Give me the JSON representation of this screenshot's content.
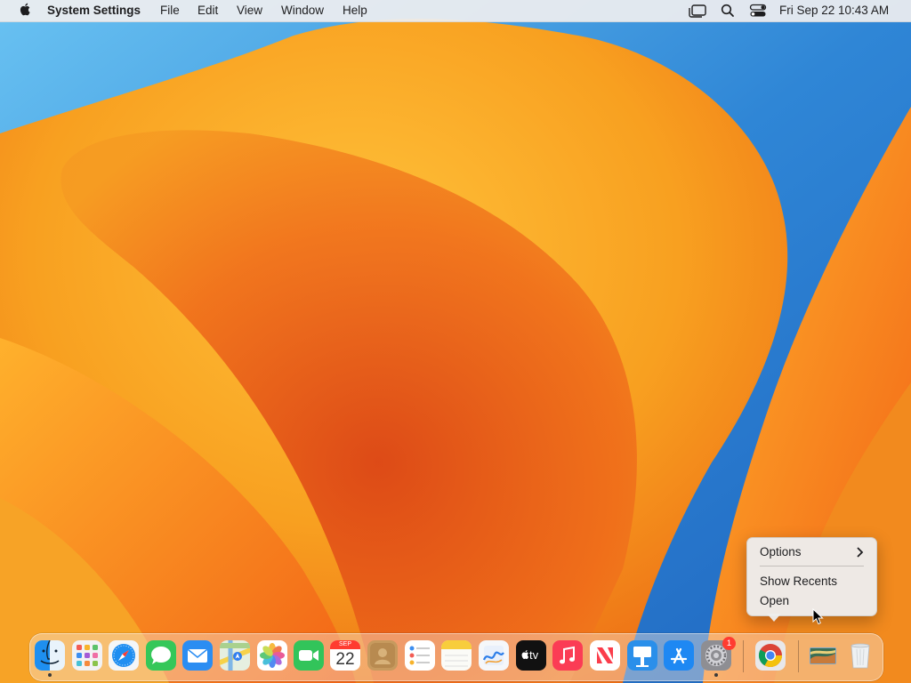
{
  "menubar": {
    "app_name": "System Settings",
    "menus": [
      "File",
      "Edit",
      "View",
      "Window",
      "Help"
    ],
    "clock": "Fri Sep 22  10:43 AM",
    "status_icons": [
      "stage-manager-icon",
      "search-icon",
      "control-center-icon"
    ]
  },
  "context_menu": {
    "items": [
      {
        "label": "Options",
        "has_submenu": true
      },
      {
        "label": "Show Recents"
      },
      {
        "label": "Open"
      }
    ]
  },
  "dock": {
    "apps": [
      {
        "name": "finder",
        "running": true
      },
      {
        "name": "launchpad"
      },
      {
        "name": "safari"
      },
      {
        "name": "messages"
      },
      {
        "name": "mail"
      },
      {
        "name": "maps"
      },
      {
        "name": "photos"
      },
      {
        "name": "facetime"
      },
      {
        "name": "calendar",
        "month": "SEP",
        "day": "22"
      },
      {
        "name": "contacts"
      },
      {
        "name": "reminders"
      },
      {
        "name": "notes"
      },
      {
        "name": "freeform"
      },
      {
        "name": "tv",
        "label": "tv"
      },
      {
        "name": "music"
      },
      {
        "name": "news"
      },
      {
        "name": "keynote"
      },
      {
        "name": "app-store"
      },
      {
        "name": "system-settings",
        "running": true,
        "badge": "1"
      },
      {
        "name": "chrome"
      },
      {
        "name": "downloads-stack"
      },
      {
        "name": "trash"
      }
    ]
  },
  "colors": {
    "wallpaper_orange": "#f39a1e",
    "wallpaper_blue": "#2f86d6",
    "badge_red": "#ff3b30"
  }
}
